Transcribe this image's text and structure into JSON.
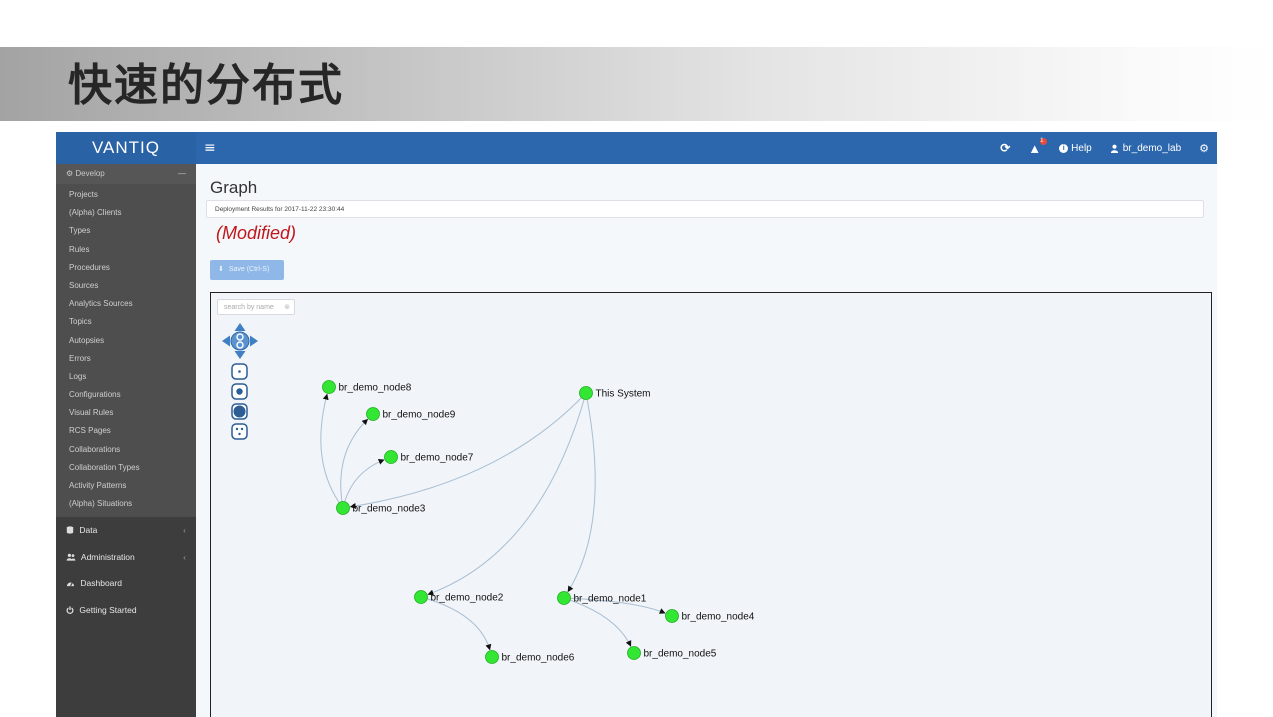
{
  "slide": {
    "title": "快速的分布式"
  },
  "app": {
    "logo": "VANTIQ",
    "topbar": {
      "help_label": "Help",
      "user_label": "br_demo_lab",
      "alert_count": "1"
    },
    "sidebar": {
      "section": "Develop",
      "items": [
        "Projects",
        "(Alpha) Clients",
        "Types",
        "Rules",
        "Procedures",
        "Sources",
        "Analytics Sources",
        "Topics",
        "Autopsies",
        "Errors",
        "Logs",
        "Configurations",
        "Visual Rules",
        "RCS Pages",
        "Collaborations",
        "Collaboration Types",
        "Activity Patterns",
        "(Alpha) Situations"
      ],
      "main_items": [
        {
          "label": "Data",
          "icon": "database-icon",
          "chevron": "‹"
        },
        {
          "label": "Administration",
          "icon": "users-icon",
          "chevron": "‹"
        },
        {
          "label": "Dashboard",
          "icon": "dashboard-icon",
          "chevron": ""
        },
        {
          "label": "Getting Started",
          "icon": "power-icon",
          "chevron": ""
        }
      ]
    },
    "page": {
      "title": "Graph",
      "deployment_results": "Deployment Results for 2017-11-22 23:30:44",
      "status": "(Modified)",
      "save_button": "Save (Ctrl-S)"
    },
    "graph": {
      "search_placeholder": "search by name",
      "node_color": "#33e633",
      "edge_color": "#a8bed3",
      "nodes": [
        {
          "id": "sys",
          "label": "This System"
        },
        {
          "id": "n8",
          "label": "br_demo_node8"
        },
        {
          "id": "n9",
          "label": "br_demo_node9"
        },
        {
          "id": "n7",
          "label": "br_demo_node7"
        },
        {
          "id": "n3",
          "label": "br_demo_node3"
        },
        {
          "id": "n2",
          "label": "br_demo_node2"
        },
        {
          "id": "n1",
          "label": "br_demo_node1"
        },
        {
          "id": "n4",
          "label": "br_demo_node4"
        },
        {
          "id": "n6",
          "label": "br_demo_node6"
        },
        {
          "id": "n5",
          "label": "br_demo_node5"
        }
      ],
      "edges": [
        {
          "from": "sys",
          "to": "n3"
        },
        {
          "from": "sys",
          "to": "n2"
        },
        {
          "from": "sys",
          "to": "n1"
        },
        {
          "from": "n3",
          "to": "n8"
        },
        {
          "from": "n3",
          "to": "n9"
        },
        {
          "from": "n3",
          "to": "n7"
        },
        {
          "from": "n2",
          "to": "n6"
        },
        {
          "from": "n1",
          "to": "n5"
        },
        {
          "from": "n1",
          "to": "n4"
        }
      ]
    }
  }
}
